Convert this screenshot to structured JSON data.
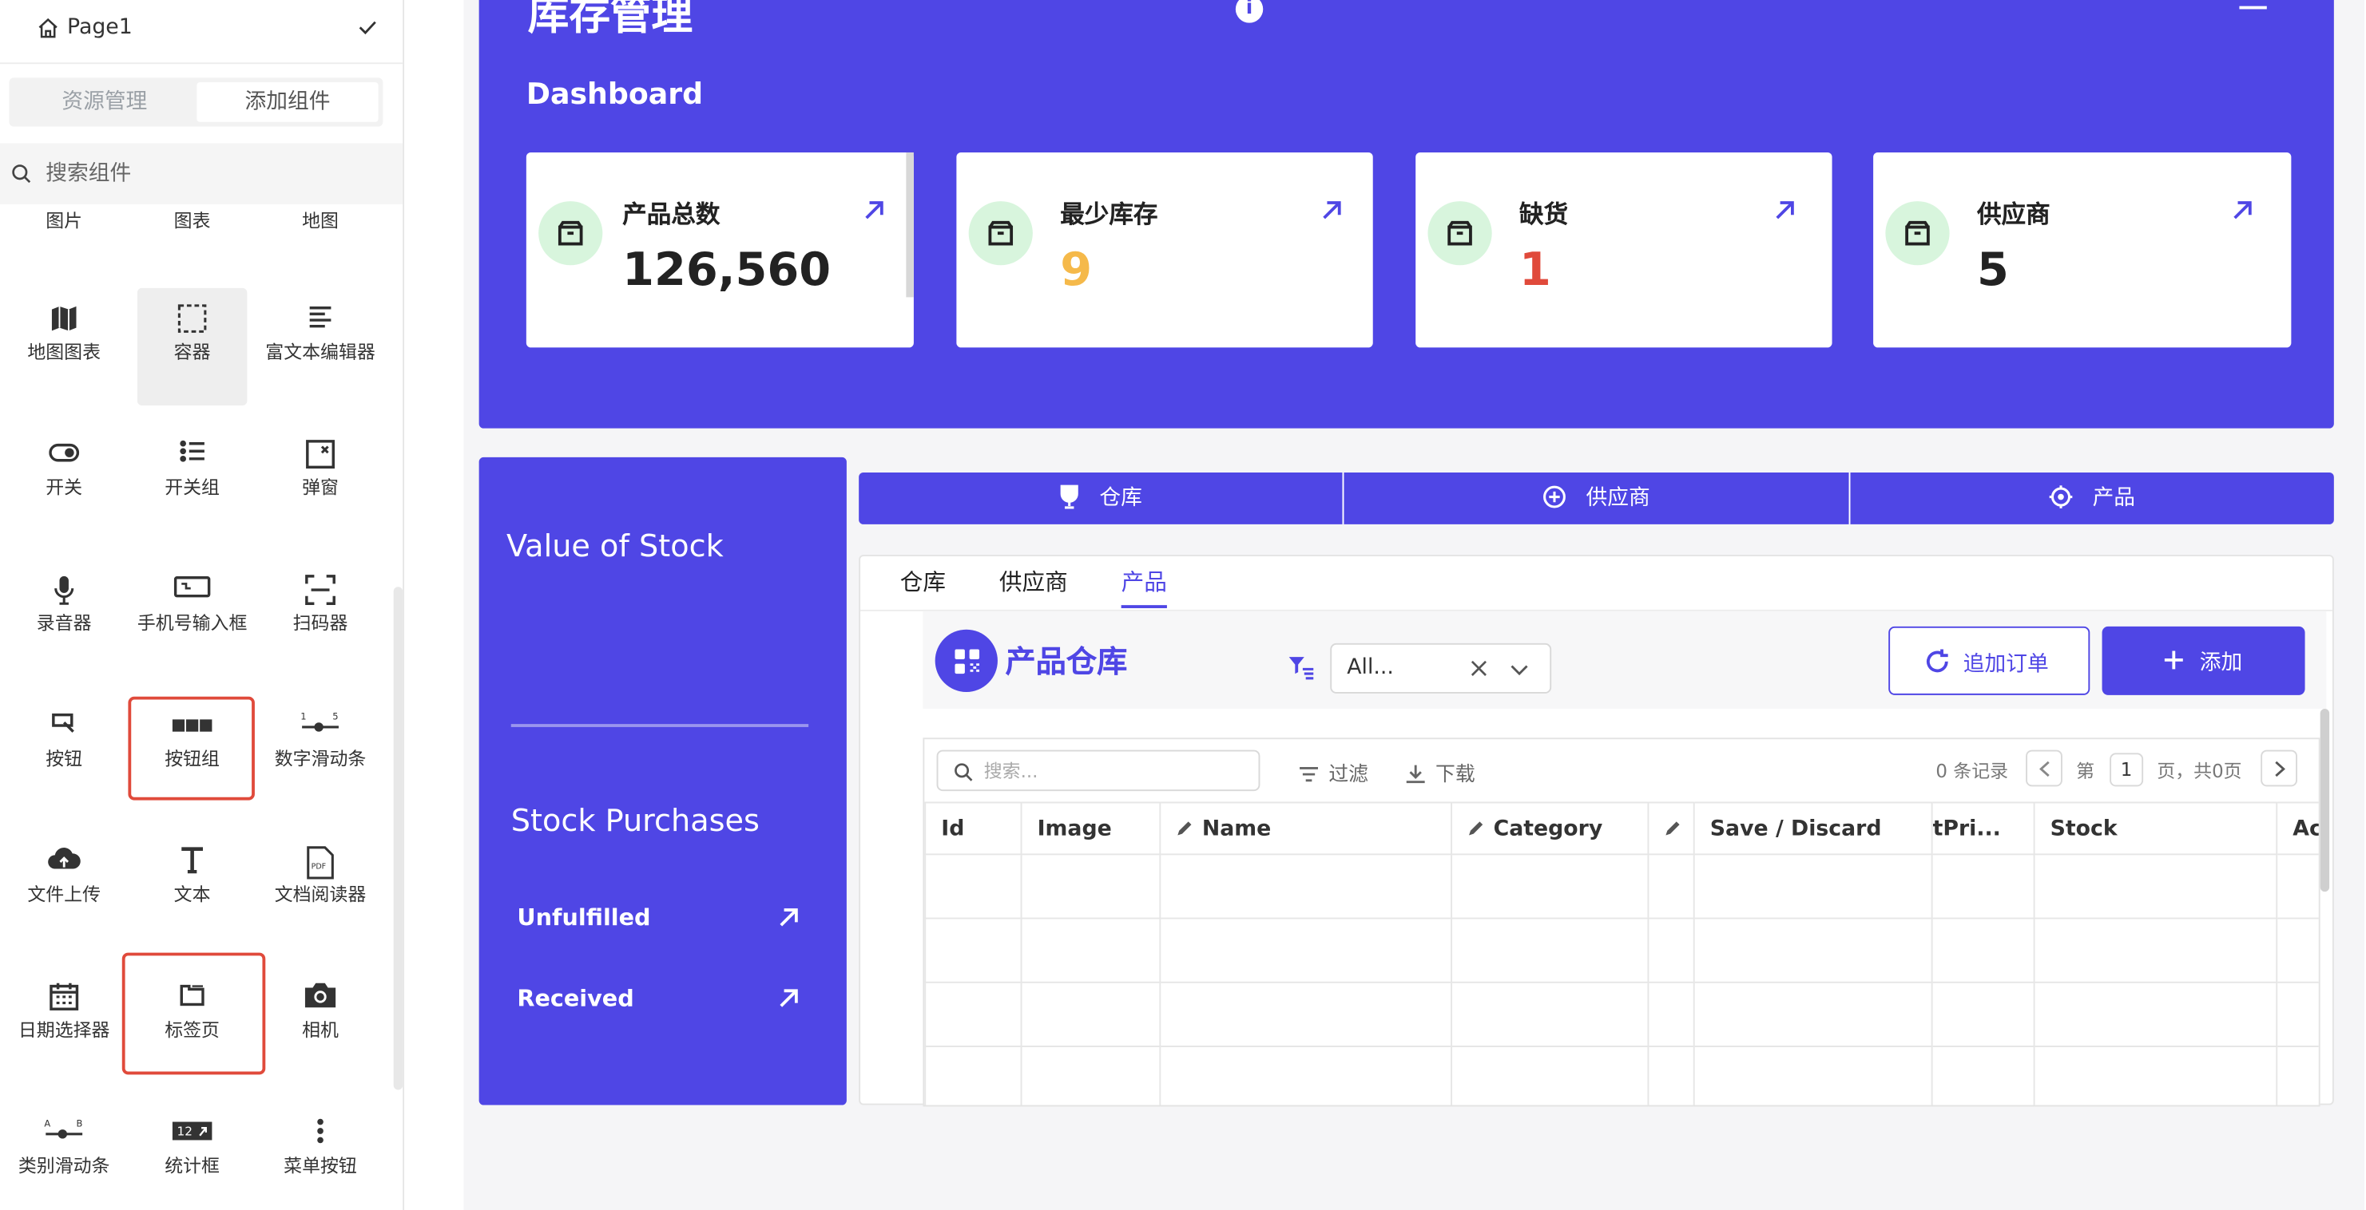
{
  "sidebar": {
    "page_name": "Page1",
    "tabs": [
      {
        "label": "资源管理",
        "active": false
      },
      {
        "label": "添加组件",
        "active": true
      }
    ],
    "search": {
      "placeholder": "搜索组件"
    },
    "components": [
      {
        "label": "图片",
        "icon": "image-icon"
      },
      {
        "label": "图表",
        "icon": "chart-icon"
      },
      {
        "label": "地图",
        "icon": "map-icon"
      },
      {
        "label": "地图图表",
        "icon": "map-chart-icon"
      },
      {
        "label": "容器",
        "icon": "container-icon"
      },
      {
        "label": "富文本编辑器",
        "icon": "rich-text-icon"
      },
      {
        "label": "开关",
        "icon": "switch-icon"
      },
      {
        "label": "开关组",
        "icon": "switch-group-icon"
      },
      {
        "label": "弹窗",
        "icon": "modal-icon"
      },
      {
        "label": "录音器",
        "icon": "microphone-icon"
      },
      {
        "label": "手机号输入框",
        "icon": "phone-input-icon"
      },
      {
        "label": "扫码器",
        "icon": "scanner-icon"
      },
      {
        "label": "按钮",
        "icon": "button-icon"
      },
      {
        "label": "按钮组",
        "icon": "button-group-icon"
      },
      {
        "label": "数字滑动条",
        "icon": "number-slider-icon"
      },
      {
        "label": "文件上传",
        "icon": "cloud-upload-icon"
      },
      {
        "label": "文本",
        "icon": "text-icon"
      },
      {
        "label": "文档阅读器",
        "icon": "pdf-icon"
      },
      {
        "label": "日期选择器",
        "icon": "calendar-icon"
      },
      {
        "label": "标签页",
        "icon": "tabs-icon"
      },
      {
        "label": "相机",
        "icon": "camera-icon"
      },
      {
        "label": "类别滑动条",
        "icon": "category-slider-icon"
      },
      {
        "label": "统计框",
        "icon": "stat-box-icon"
      },
      {
        "label": "菜单按钮",
        "icon": "menu-dots-icon"
      }
    ]
  },
  "hero": {
    "title": "库存管理",
    "subtitle": "Dashboard",
    "accent": "#4f46e5",
    "cards": [
      {
        "title": "产品总数",
        "value": "126,560",
        "color": "#222222"
      },
      {
        "title": "最少库存",
        "value": "9",
        "color": "#f5b94a"
      },
      {
        "title": "缺货",
        "value": "1",
        "color": "#e04a3b"
      },
      {
        "title": "供应商",
        "value": "5",
        "color": "#222222"
      }
    ]
  },
  "stock_panel": {
    "value_title": "Value of Stock",
    "purchases_title": "Stock Purchases",
    "rows": [
      "Unfulfilled",
      "Received"
    ]
  },
  "top_buttons": [
    "仓库",
    "供应商",
    "产品"
  ],
  "tabs": [
    "仓库",
    "供应商",
    "产品"
  ],
  "table_header": {
    "title": "产品仓库",
    "filter_value": "All...",
    "refresh_button": "追加订单",
    "add_button": "添加"
  },
  "grid": {
    "search_placeholder": "搜索...",
    "filter_label": "过滤",
    "download_label": "下载",
    "records": "0 条记录",
    "page_prefix": "第",
    "page_number": "1",
    "page_suffix": "页，共0页",
    "columns": [
      "Id",
      "Image",
      "Name",
      "Category",
      "",
      "Save / Discard",
      "tPri...",
      "Stock",
      "Ac"
    ],
    "rows": [
      [
        "",
        "",
        "",
        "",
        "",
        "",
        "",
        "",
        ""
      ],
      [
        "",
        "",
        "",
        "",
        "",
        "",
        "",
        "",
        ""
      ],
      [
        "",
        "",
        "",
        "",
        "",
        "",
        "",
        "",
        ""
      ],
      [
        "",
        "",
        "",
        "",
        "",
        "",
        "",
        "",
        ""
      ]
    ]
  }
}
